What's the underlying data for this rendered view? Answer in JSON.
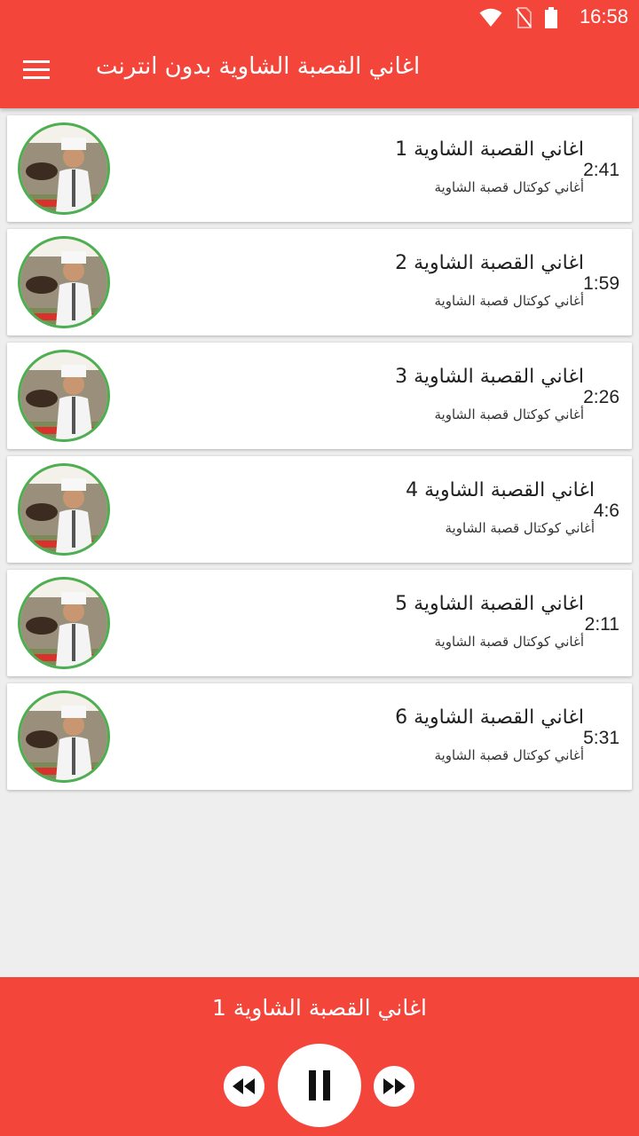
{
  "status_bar": {
    "time": "16:58",
    "icons": [
      "wifi-icon",
      "no-sim-icon",
      "battery-icon"
    ]
  },
  "app_bar": {
    "title": "اغاني القصبة الشاوية بدون انترنت",
    "menu_icon": "hamburger-menu-icon",
    "color": "#f4453b"
  },
  "tracks": [
    {
      "title": "اغاني القصبة الشاوية 1",
      "subtitle": "أغاني كوكتال قصبة الشاوية",
      "duration": "2:41"
    },
    {
      "title": "اغاني القصبة الشاوية 2",
      "subtitle": "أغاني كوكتال قصبة الشاوية",
      "duration": "1:59"
    },
    {
      "title": "اغاني القصبة الشاوية 3",
      "subtitle": "أغاني كوكتال قصبة الشاوية",
      "duration": "2:26"
    },
    {
      "title": "اغاني القصبة الشاوية 4",
      "subtitle": "أغاني كوكتال قصبة الشاوية",
      "duration": "4:6"
    },
    {
      "title": "اغاني القصبة الشاوية 5",
      "subtitle": "أغاني كوكتال قصبة الشاوية",
      "duration": "2:11"
    },
    {
      "title": "اغاني القصبة الشاوية 6",
      "subtitle": "أغاني كوكتال قصبة الشاوية",
      "duration": "5:31"
    }
  ],
  "player": {
    "now_playing": "اغاني القصبة الشاوية 1",
    "controls": [
      "rewind-icon",
      "pause-icon",
      "fast-forward-icon"
    ]
  },
  "colors": {
    "accent": "#f4453b",
    "thumb_border": "#4caf50",
    "background": "#eeeeee"
  }
}
